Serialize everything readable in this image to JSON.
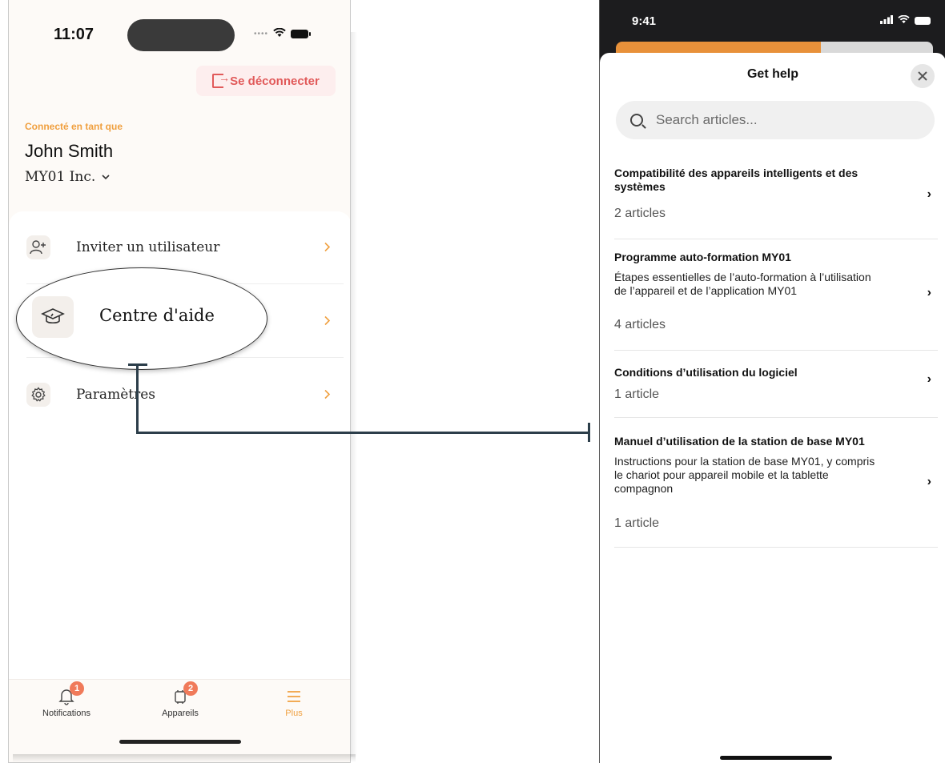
{
  "left_phone": {
    "status_time": "11:07",
    "logout_label": "Se déconnecter",
    "connected_label": "Connecté en tant que",
    "user_name": "John Smith",
    "org_name": "MY01 Inc.",
    "menu": [
      {
        "label": "Inviter un utilisateur",
        "icon": "add-user-icon"
      },
      {
        "label": "Centre d'aide",
        "icon": "graduation-cap-icon"
      },
      {
        "label": "Paramètres",
        "icon": "gear-icon"
      }
    ],
    "tabs": [
      {
        "label": "Notifications",
        "icon": "bell-icon",
        "badge": "1"
      },
      {
        "label": "Appareils",
        "icon": "devices-icon",
        "badge": "2"
      },
      {
        "label": "Plus",
        "icon": "menu-icon",
        "active": true
      }
    ]
  },
  "right_phone": {
    "status_time": "9:41",
    "sheet_title": "Get help",
    "search_placeholder": "Search articles...",
    "articles": [
      {
        "title": "Compatibilité des appareils intelligents et des systèmes",
        "description": "",
        "count": "2 articles"
      },
      {
        "title": "Programme auto-formation MY01",
        "description": "Étapes essentielles de l’auto-formation à l’utilisation de l’appareil et de l’application MY01",
        "count": "4 articles"
      },
      {
        "title": "Conditions d’utilisation du logiciel",
        "description": "",
        "count": "1 article"
      },
      {
        "title": "Manuel d’utilisation de la station de base MY01",
        "description": "Instructions pour la station de base MY01, y compris le chariot pour appareil mobile et la tablette compagnon",
        "count": "1 article"
      }
    ]
  },
  "colors": {
    "accent_orange": "#f0a040",
    "logout_red": "#e15a5a",
    "badge": "#f07a5a",
    "connector": "#2c3e4a"
  }
}
